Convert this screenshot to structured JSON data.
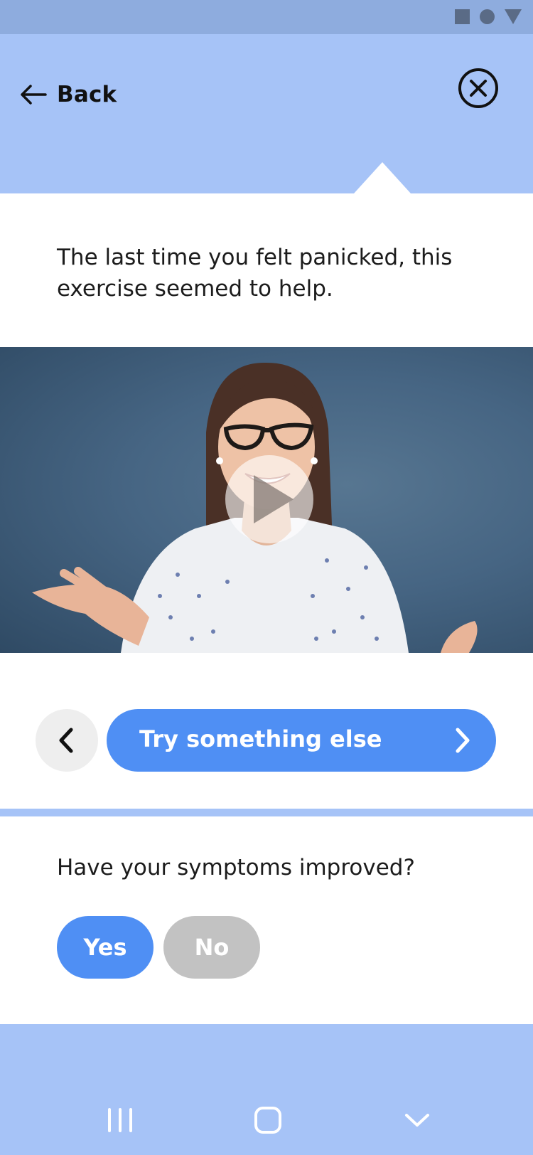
{
  "header": {
    "back_label": "Back"
  },
  "card": {
    "suggestion_text": "The last time you felt panicked, this exercise seemed to help.",
    "video": {
      "has_play_button": true
    },
    "try_button_label": "Try something else"
  },
  "survey": {
    "question": "Have your symptoms improved?",
    "yes_label": "Yes",
    "no_label": "No"
  },
  "colors": {
    "header_bg": "#a6c3f7",
    "status_bar_bg": "#8eacde",
    "primary_button": "#4f8ff4",
    "secondary_button": "#c2c2c2",
    "prev_button": "#eeeeee"
  },
  "icons": {
    "back": "arrow-left-icon",
    "close": "close-circle-icon",
    "play": "play-icon",
    "prev": "chevron-left-icon",
    "next": "chevron-right-icon",
    "nav_recents": "recents-icon",
    "nav_home": "home-icon",
    "nav_back": "chevron-down-icon"
  }
}
